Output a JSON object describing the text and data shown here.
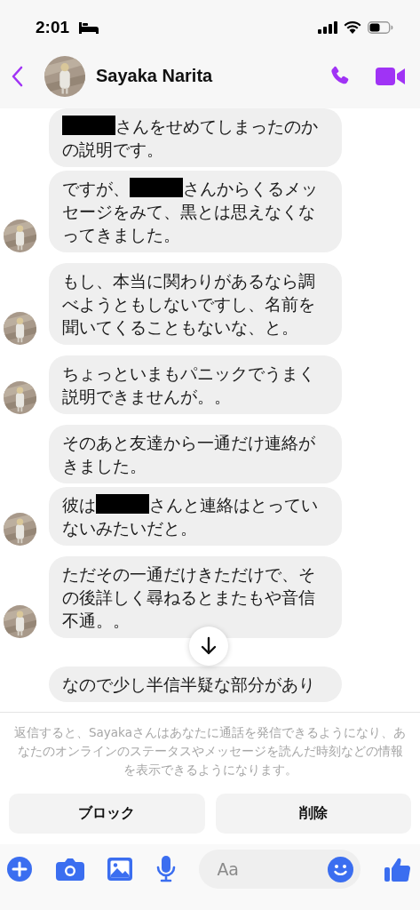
{
  "status_bar": {
    "time": "2:01"
  },
  "header": {
    "contact_name": "Sayaka Narita"
  },
  "messages": [
    {
      "show_avatar": false,
      "parts": [
        {
          "kind": "redacted"
        },
        {
          "kind": "text",
          "text": "さんをせめてしまったのかの説明です。"
        }
      ]
    },
    {
      "show_avatar": true,
      "parts": [
        {
          "kind": "text",
          "text": "ですが、"
        },
        {
          "kind": "redacted"
        },
        {
          "kind": "text",
          "text": "さんからくるメッセージをみて、黒とは思えなくなってきました。"
        }
      ]
    },
    {
      "show_avatar": true,
      "parts": [
        {
          "kind": "text",
          "text": "もし、本当に関わりがあるなら調べようともしないですし、名前を聞いてくることもないな、と。"
        }
      ]
    },
    {
      "show_avatar": true,
      "parts": [
        {
          "kind": "text",
          "text": "ちょっといまもパニックでうまく説明できませんが。。"
        }
      ]
    },
    {
      "show_avatar": false,
      "parts": [
        {
          "kind": "text",
          "text": "そのあと友達から一通だけ連絡がきました。"
        }
      ]
    },
    {
      "show_avatar": true,
      "parts": [
        {
          "kind": "text",
          "text": "彼は"
        },
        {
          "kind": "redacted"
        },
        {
          "kind": "text",
          "text": "さんと連絡はとっていないみたいだと。"
        }
      ]
    },
    {
      "show_avatar": true,
      "parts": [
        {
          "kind": "text",
          "text": "ただその一通だけきただけで、その後詳しく尋ねるとまたもや音信不通。。"
        }
      ]
    },
    {
      "show_avatar": false,
      "parts": [
        {
          "kind": "text",
          "text": "なので少し半信半疑な部分があり"
        }
      ]
    }
  ],
  "notice": "返信すると、Sayakaさんはあなたに通話を発信できるようになり、あなたのオンラインのステータスやメッセージを読んだ時刻などの情報を表示できるようになります。",
  "actions": [
    "ブロック",
    "削除"
  ],
  "composer": {
    "placeholder": "Aa"
  }
}
